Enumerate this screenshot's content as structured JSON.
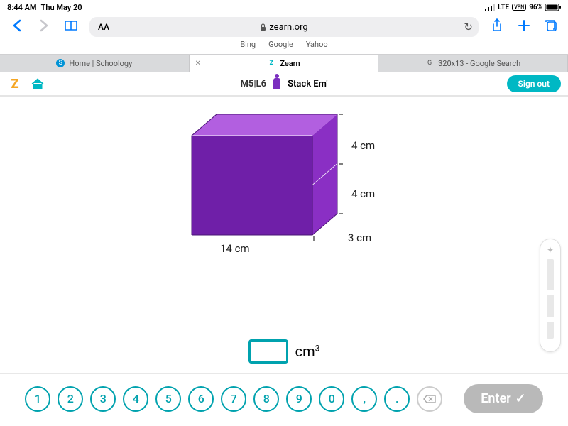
{
  "status": {
    "time": "8:44 AM",
    "date": "Thu May 20",
    "network": "LTE",
    "vpn": "VPN",
    "battery_pct": "96%"
  },
  "safari": {
    "aa_label": "AA",
    "url_host": "zearn.org",
    "engines": [
      "Bing",
      "Google",
      "Yahoo"
    ]
  },
  "tabs": [
    {
      "label": "Home | Schoology",
      "favicon": "S"
    },
    {
      "label": "Zearn",
      "favicon": "Z",
      "active": true
    },
    {
      "label": "320x13 - Google Search",
      "favicon": "G"
    }
  ],
  "app": {
    "lesson_code": "M5|L6",
    "lesson_title": "Stack Em'",
    "sign_out": "Sign out"
  },
  "figure": {
    "length_label": "14 cm",
    "top_height_label": "4 cm",
    "bottom_height_label": "4 cm",
    "depth_label": "3 cm"
  },
  "answer": {
    "value": "",
    "unit_base": "cm",
    "unit_exp": "3"
  },
  "keypad": {
    "keys": [
      "1",
      "2",
      "3",
      "4",
      "5",
      "6",
      "7",
      "8",
      "9",
      "0",
      ",",
      "."
    ],
    "enter": "Enter"
  }
}
